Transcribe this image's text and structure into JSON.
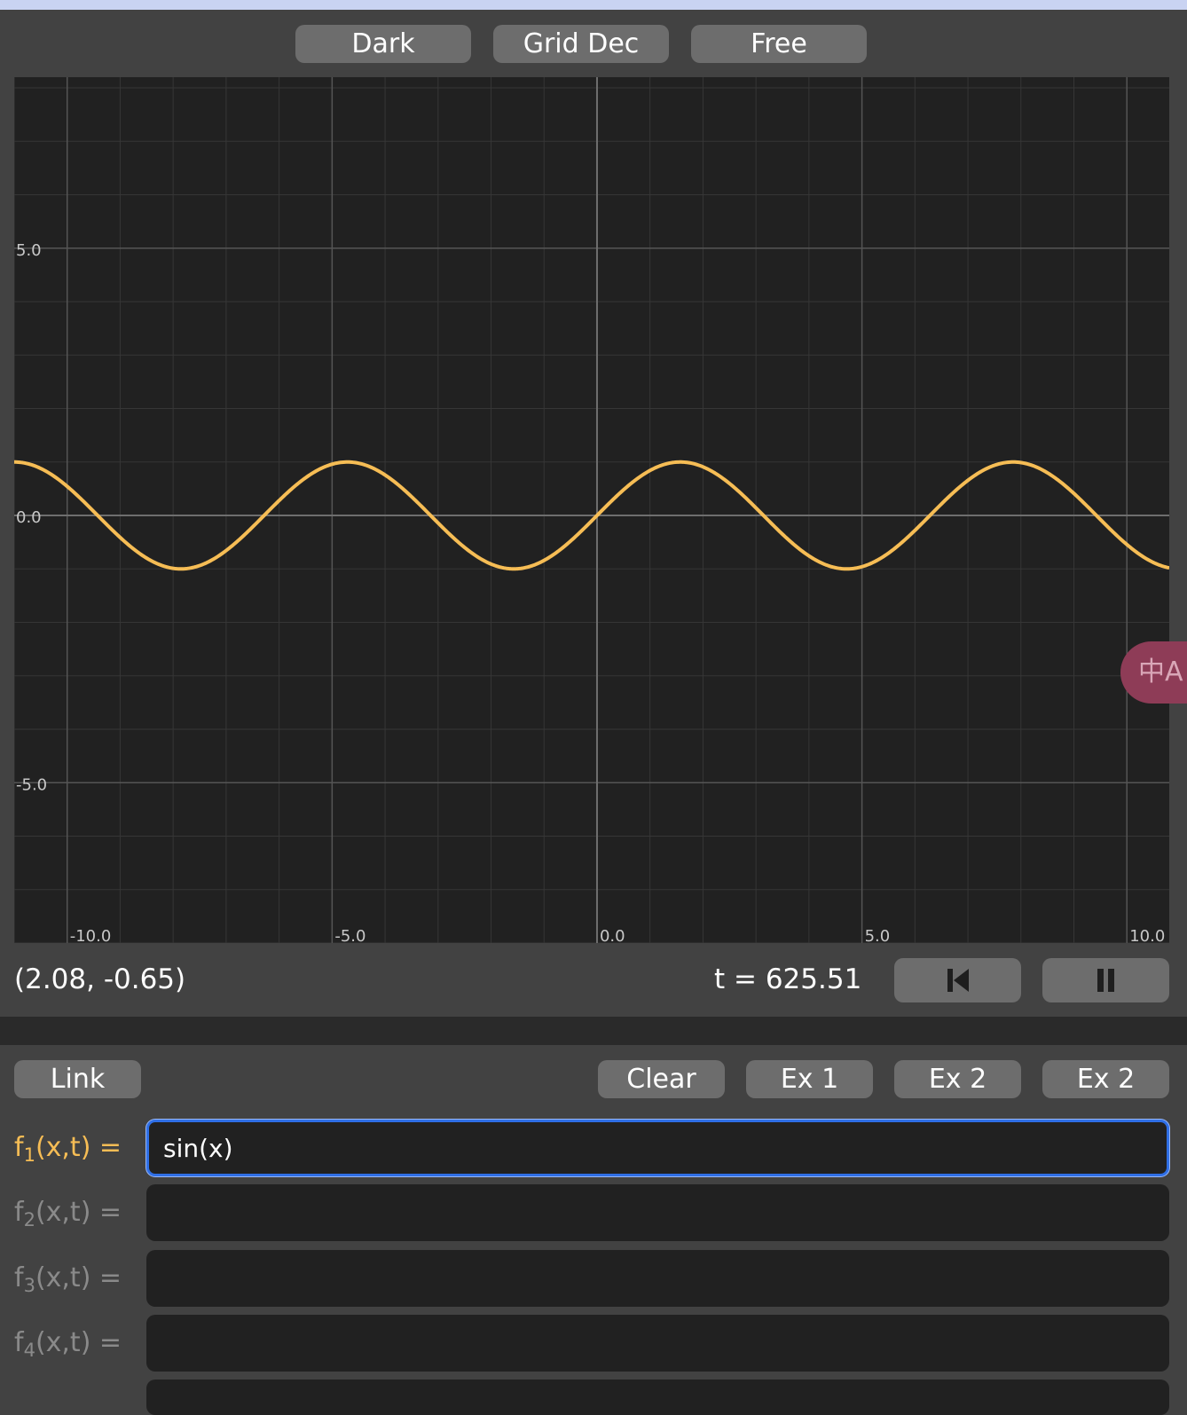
{
  "top_toolbar": {
    "buttons": [
      {
        "label": "Dark"
      },
      {
        "label": "Grid Dec"
      },
      {
        "label": "Free"
      }
    ]
  },
  "colors": {
    "background": "#424242",
    "plot_background": "#212121",
    "curve": "#f6bd55",
    "button": "#6d6d6d",
    "focus": "#2f6fe6"
  },
  "chart_data": {
    "type": "line",
    "x_range": [
      -11.0,
      10.8
    ],
    "y_range": [
      -8.0,
      8.2
    ],
    "x_ticks": [
      -10.0,
      -5.0,
      0.0,
      5.0,
      10.0
    ],
    "x_tick_labels": [
      "-10.0",
      "-5.0",
      "0.0",
      "5.0",
      "10.0"
    ],
    "y_ticks": [
      5.0,
      0.0,
      -5.0
    ],
    "y_tick_labels": [
      "5.0",
      "0.0",
      "-5.0"
    ],
    "minor_grid_step": 1.0,
    "grid": true,
    "series": [
      {
        "expression": "sin(x)",
        "color": "#f6bd55"
      }
    ]
  },
  "status_bar": {
    "coordinates": "(2.08, -0.65)",
    "time": "t = 625.51",
    "reset_icon": "skip-back-icon",
    "pause_icon": "pause-icon"
  },
  "bottom_toolbar": {
    "link_label": "Link",
    "clear_label": "Clear",
    "ex1_label": "Ex 1",
    "ex2_label": "Ex 2",
    "ex2b_label": "Ex 2"
  },
  "functions": [
    {
      "name": "f",
      "sub": "1",
      "args": "(x,t) =",
      "value": "sin(x)"
    },
    {
      "name": "f",
      "sub": "2",
      "args": "(x,t) =",
      "value": ""
    },
    {
      "name": "f",
      "sub": "3",
      "args": "(x,t) =",
      "value": ""
    },
    {
      "name": "f",
      "sub": "4",
      "args": "(x,t) =",
      "value": ""
    }
  ],
  "translate_badge": {
    "icon": "translate-icon",
    "glyph": "中A"
  }
}
